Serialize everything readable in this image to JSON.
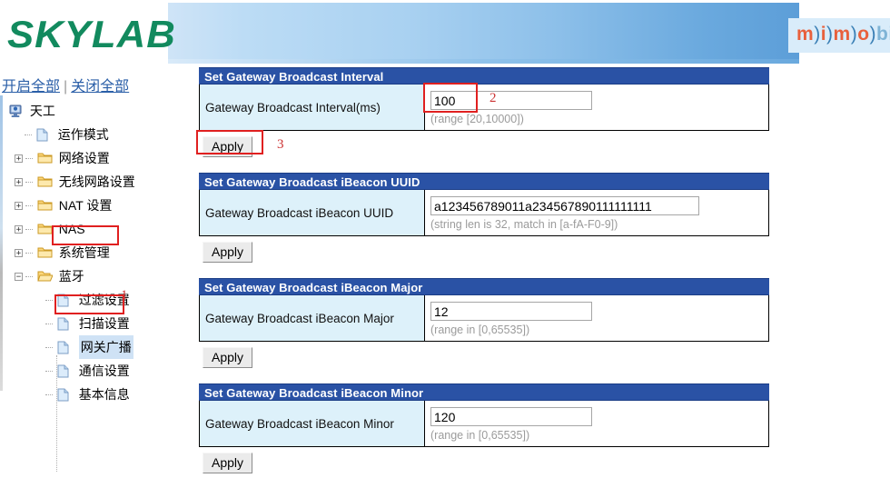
{
  "brand": {
    "logo_text": "SKYLAB",
    "logo_color": "#128a5e",
    "mimo_parts": [
      "m",
      ")",
      "i",
      ")",
      "m",
      ")",
      "o",
      ")",
      "bi"
    ]
  },
  "toplinks": {
    "expand_all": "开启全部",
    "separator": "|",
    "collapse_all": "关闭全部"
  },
  "sidebar": {
    "root": {
      "label": "天工",
      "icon": "computer-icon"
    },
    "items": [
      {
        "label": "运作模式",
        "icon": "page-icon",
        "level": 2,
        "toggle": "none"
      },
      {
        "label": "网络设置",
        "icon": "folder-icon",
        "level": 2,
        "toggle": "plus"
      },
      {
        "label": "无线网路设置",
        "icon": "folder-icon",
        "level": 2,
        "toggle": "plus"
      },
      {
        "label": "NAT 设置",
        "icon": "folder-icon",
        "level": 2,
        "toggle": "plus"
      },
      {
        "label": "NAS",
        "icon": "folder-icon",
        "level": 2,
        "toggle": "plus"
      },
      {
        "label": "系统管理",
        "icon": "folder-icon",
        "level": 2,
        "toggle": "plus"
      },
      {
        "label": "蓝牙",
        "icon": "folder-open-icon",
        "level": 2,
        "toggle": "minus",
        "annotated": true
      },
      {
        "label": "过滤设置",
        "icon": "page-icon",
        "level": 3,
        "toggle": "none"
      },
      {
        "label": "扫描设置",
        "icon": "page-icon",
        "level": 3,
        "toggle": "none"
      },
      {
        "label": "网关广播",
        "icon": "page-icon",
        "level": 3,
        "toggle": "none",
        "selected": true,
        "annotated": true
      },
      {
        "label": "通信设置",
        "icon": "page-icon",
        "level": 3,
        "toggle": "none"
      },
      {
        "label": "基本信息",
        "icon": "page-icon",
        "level": 3,
        "toggle": "none"
      }
    ]
  },
  "sections": [
    {
      "title": "Set Gateway Broadcast Interval",
      "field_label": "Gateway Broadcast Interval(ms)",
      "value": "100",
      "hint": "(range [20,10000])",
      "apply_label": "Apply",
      "input_width": "num"
    },
    {
      "title": "Set Gateway Broadcast iBeacon UUID",
      "field_label": "Gateway Broadcast iBeacon UUID",
      "value": "a123456789011a234567890111111111",
      "hint": "(string len is 32, match in [a-fA-F0-9])",
      "apply_label": "Apply",
      "input_width": "uuid"
    },
    {
      "title": "Set Gateway Broadcast iBeacon Major",
      "field_label": "Gateway Broadcast iBeacon Major",
      "value": "12",
      "hint": "(range in [0,65535])",
      "apply_label": "Apply",
      "input_width": "num"
    },
    {
      "title": "Set Gateway Broadcast iBeacon Minor",
      "field_label": "Gateway Broadcast iBeacon Minor",
      "value": "120",
      "hint": "(range in [0,65535])",
      "apply_label": "Apply",
      "input_width": "num"
    }
  ],
  "annotations": {
    "color": "#e02020",
    "steps": [
      {
        "number": "1",
        "target": "sidebar-item-gateway-broadcast"
      },
      {
        "number": "2",
        "target": "interval-input"
      },
      {
        "number": "3",
        "target": "interval-apply-button"
      }
    ]
  }
}
